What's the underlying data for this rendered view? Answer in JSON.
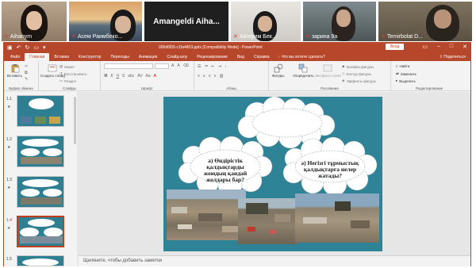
{
  "video_tiles": [
    {
      "name": "Aihanym",
      "muted": true
    },
    {
      "name": "Асем Раимбеко...",
      "muted": true
    },
    {
      "name": "Amangeldi  Aiha...",
      "muted": false
    },
    {
      "name": "Айгерим Бек...",
      "muted": true
    },
    {
      "name": "зарина 9а",
      "muted": true
    },
    {
      "name": "Temirbolat D...",
      "muted": true
    }
  ],
  "window": {
    "doc_title": "000d6f35-c1fa4803.pptx [Compatibility Mode] - PowerPoint",
    "enter_label": "Вход",
    "share_label": "Поделиться",
    "tell_me": "Что вы хотите сделать?"
  },
  "tabs": [
    "Файл",
    "Главная",
    "Вставка",
    "Конструктор",
    "Переходы",
    "Анимация",
    "Слайд-шоу",
    "Рецензирование",
    "Вид",
    "Справка"
  ],
  "active_tab": "Главная",
  "ribbon": {
    "paste": "Вставить",
    "create_slide": "Создать слайд",
    "layout": "Макет",
    "reset": "Восстановить",
    "section": "Раздел",
    "clipboard": "Буфер обмена",
    "slides": "Слайды",
    "font": "Шрифт",
    "paragraph": "Абзац",
    "shapes": "Фигуры",
    "arrange": "Упорядочить",
    "quick_styles": "Экспресс-стили",
    "fill": "Заливка фигуры",
    "outline": "Контур фигуры",
    "effects": "Эффекты фигуры",
    "drawing": "Рисование",
    "find": "Найти",
    "replace": "Заменить",
    "select": "Выделить",
    "editing": "Редактирование"
  },
  "thumbnails": [
    {
      "num": "1.1"
    },
    {
      "num": "1.2"
    },
    {
      "num": "1.3"
    },
    {
      "num": "1.4"
    },
    {
      "num": "1.5"
    }
  ],
  "slide": {
    "cloud_a": "а) Өндірістік қалдықтарды жоюдың қандай жолдары бар?",
    "cloud_e": "ә) Негізгі тұрмыстық қалдықтарға нелер жатады?"
  },
  "notes_placeholder": "Щелкните, чтобы добавить заметки",
  "colors": {
    "accent": "#b7472a",
    "slide_bg": "#2f8396"
  }
}
